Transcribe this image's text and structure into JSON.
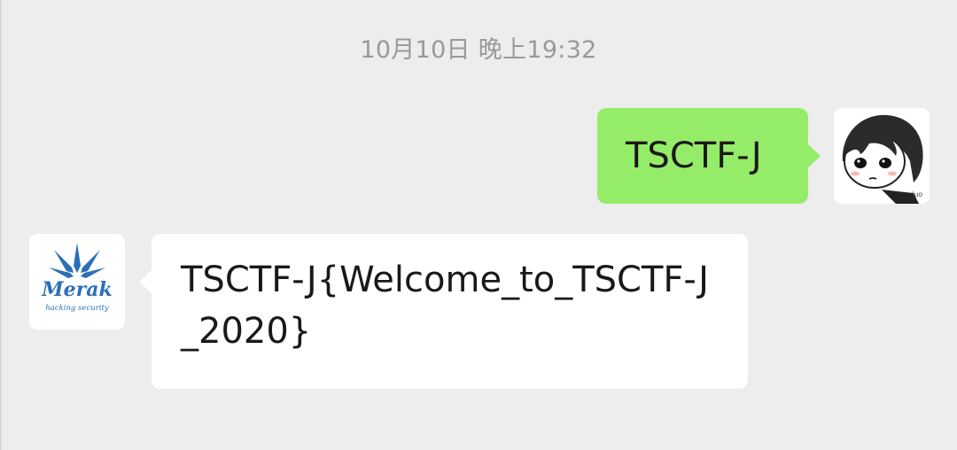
{
  "chat": {
    "timestamp": "10月10日 晚上19:32",
    "messages": [
      {
        "direction": "sent",
        "text": "TSCTF-J",
        "avatar_icon": "user-cartoon-avatar-icon",
        "bubble_color": "#95ec69"
      },
      {
        "direction": "received",
        "text": "TSCTF-J{Welcome_to_TSCTF-J_2020}",
        "avatar_icon": "merak-logo-avatar-icon",
        "avatar_logo_text": "Merak",
        "avatar_logo_subtext": "hacking security",
        "bubble_color": "#ffffff"
      }
    ]
  },
  "colors": {
    "background": "#ededed",
    "timestamp": "#999999",
    "text": "#191919",
    "logo_blue": "#2a6fb8"
  }
}
